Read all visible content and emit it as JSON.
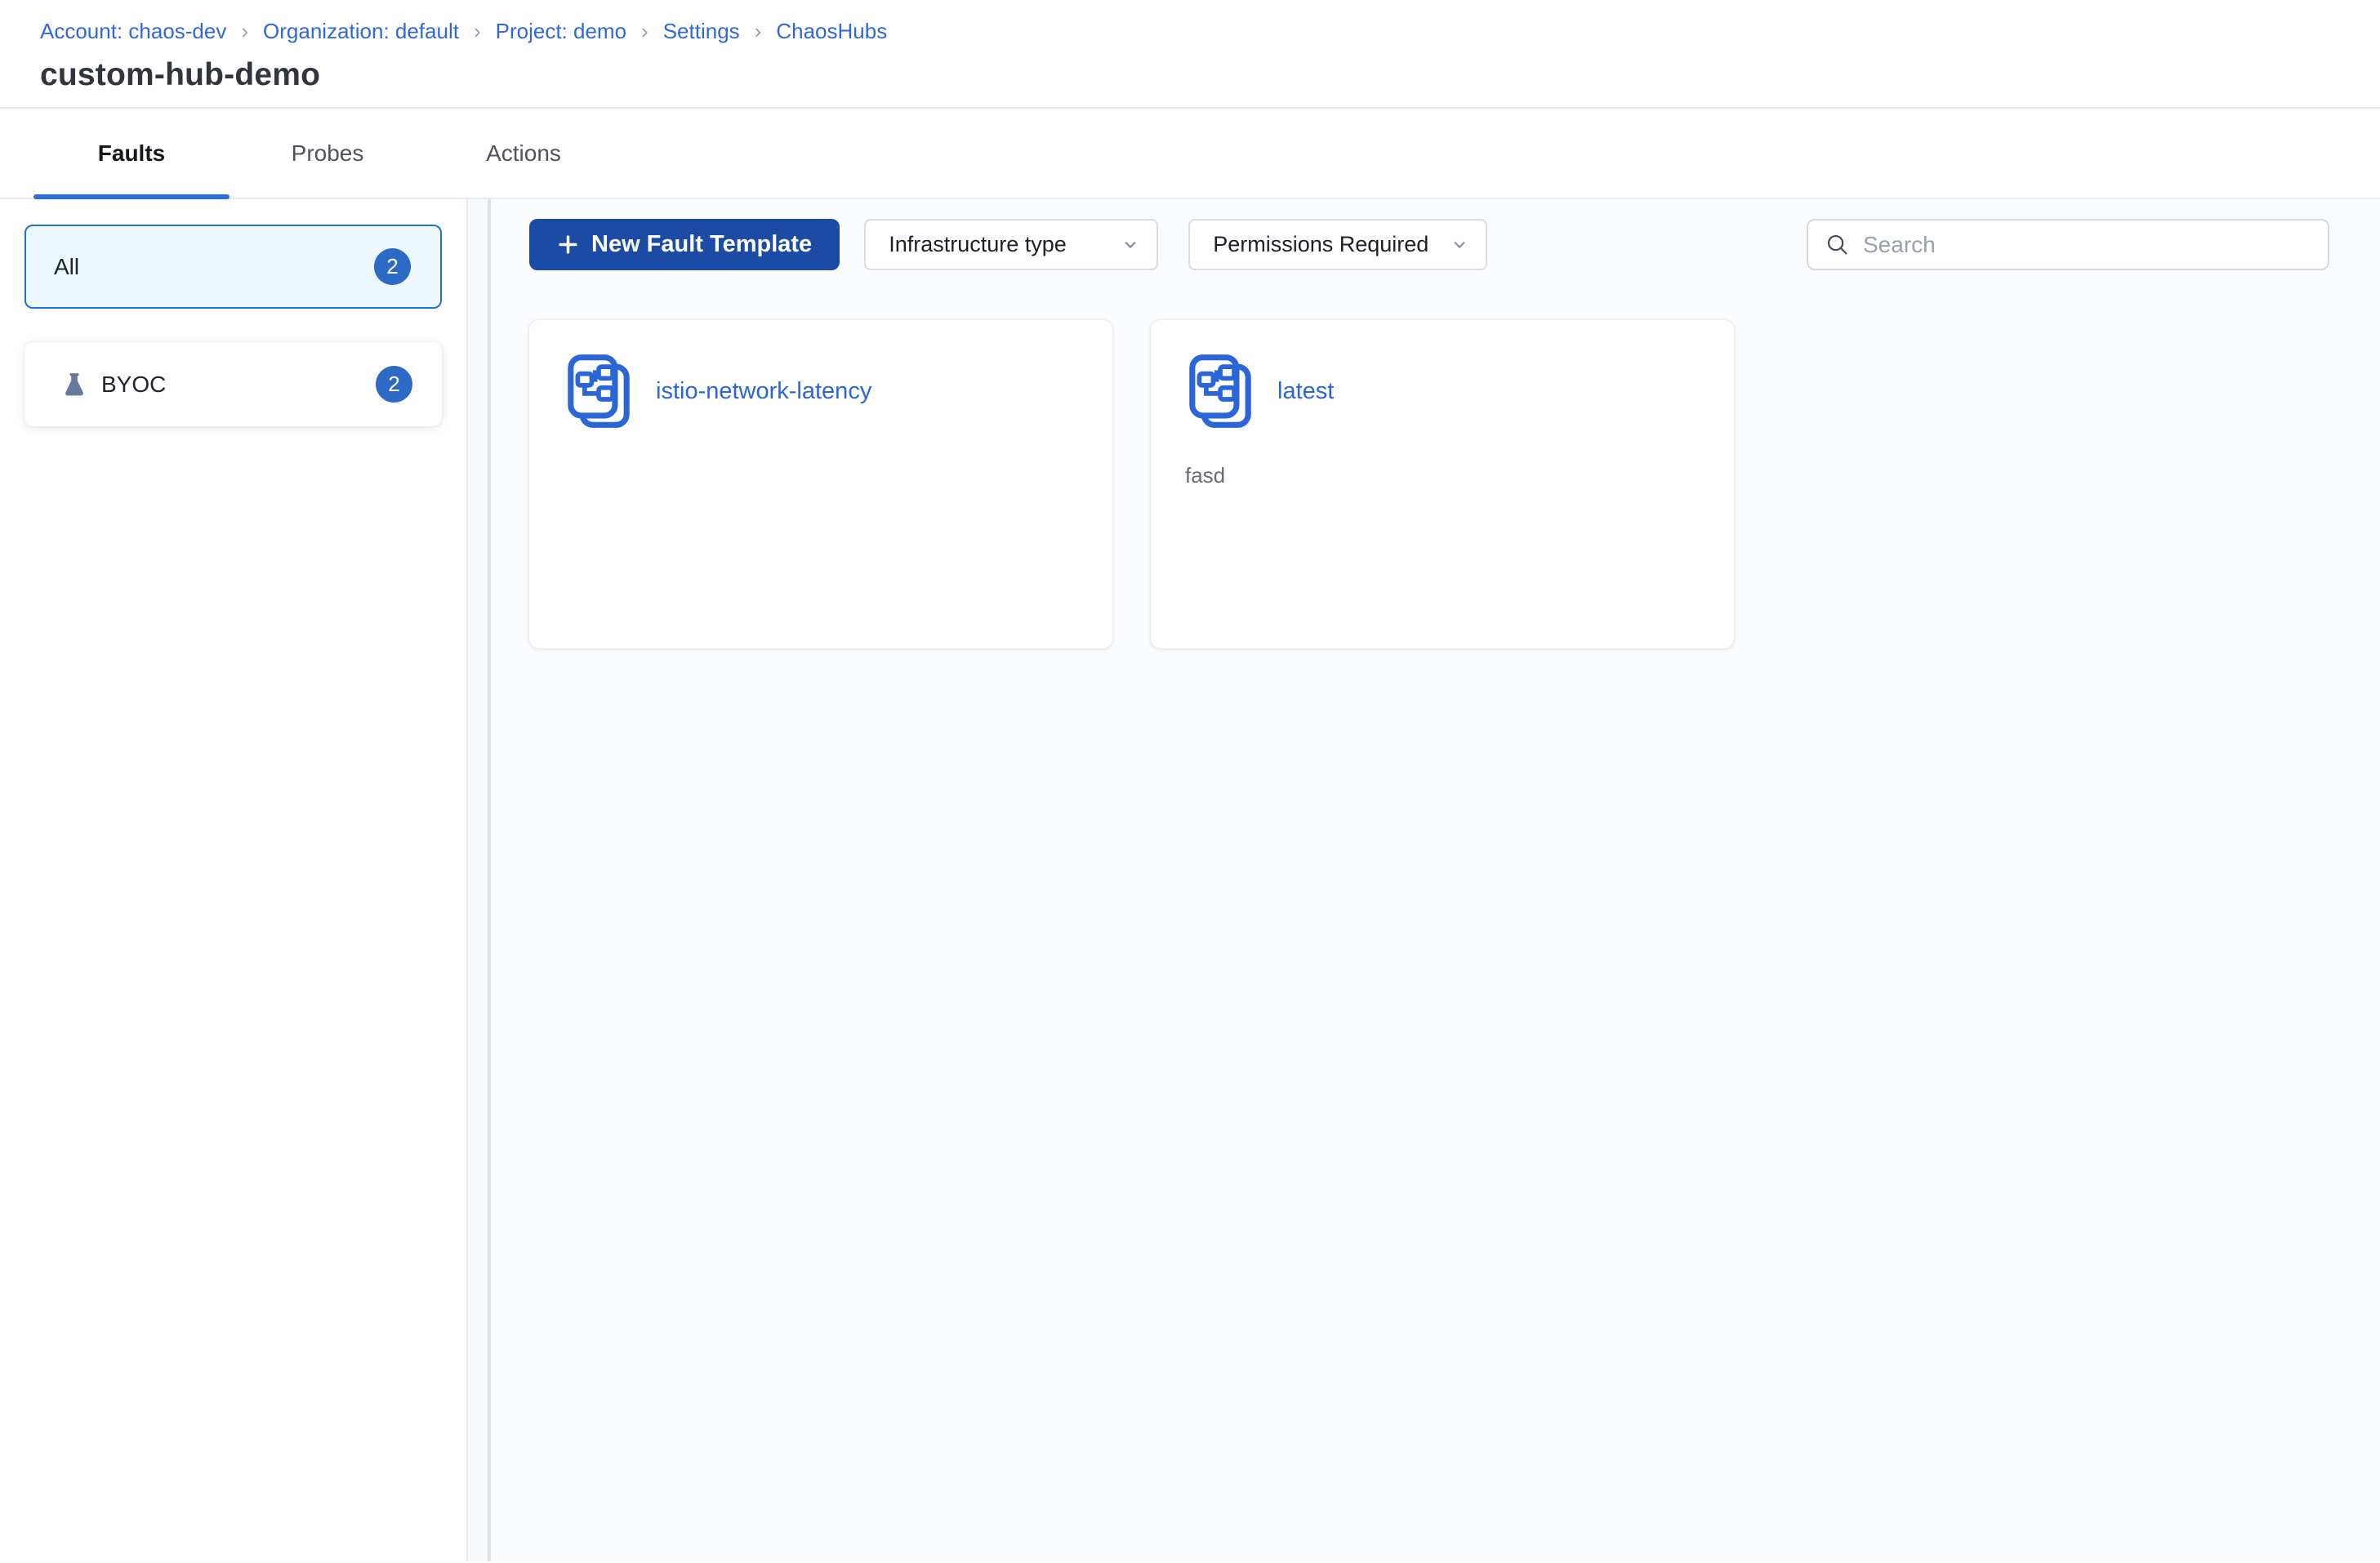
{
  "breadcrumb": {
    "separator": "›",
    "items": [
      {
        "label": "Account: chaos-dev"
      },
      {
        "label": "Organization: default"
      },
      {
        "label": "Project: demo"
      },
      {
        "label": "Settings"
      },
      {
        "label": "ChaosHubs"
      }
    ]
  },
  "page": {
    "title": "custom-hub-demo"
  },
  "tabs": [
    {
      "label": "Faults",
      "active": true
    },
    {
      "label": "Probes",
      "active": false
    },
    {
      "label": "Actions",
      "active": false
    }
  ],
  "sidebar": {
    "items": [
      {
        "label": "All",
        "count": "2",
        "active": true
      },
      {
        "label": "BYOC",
        "count": "2",
        "active": false,
        "icon": "flask-icon"
      }
    ]
  },
  "toolbar": {
    "new_button": {
      "label": "New Fault Template",
      "icon": "plus-icon"
    },
    "dropdowns": [
      {
        "label": "Infrastructure type"
      },
      {
        "label": "Permissions Required"
      }
    ],
    "search": {
      "placeholder": "Search",
      "value": "",
      "icon": "search-icon"
    }
  },
  "cards": [
    {
      "title": "istio-network-latency",
      "description": "",
      "icon": "hub-template-icon"
    },
    {
      "title": "latest",
      "description": "fasd",
      "icon": "hub-template-icon"
    }
  ],
  "colors": {
    "link_blue": "#3069d6",
    "accent_blue": "#2b6fd4",
    "button_blue": "#1c4ba5",
    "badge_blue": "#2d6ac6",
    "card_title_blue": "#2b66d8",
    "active_filter_bg": "#ecf8fd",
    "active_filter_border": "#2173d2",
    "main_bg": "#fbfcfe",
    "border_gray": "#e7e9f0",
    "title_text": "#32343f",
    "muted_text": "#696c75"
  }
}
